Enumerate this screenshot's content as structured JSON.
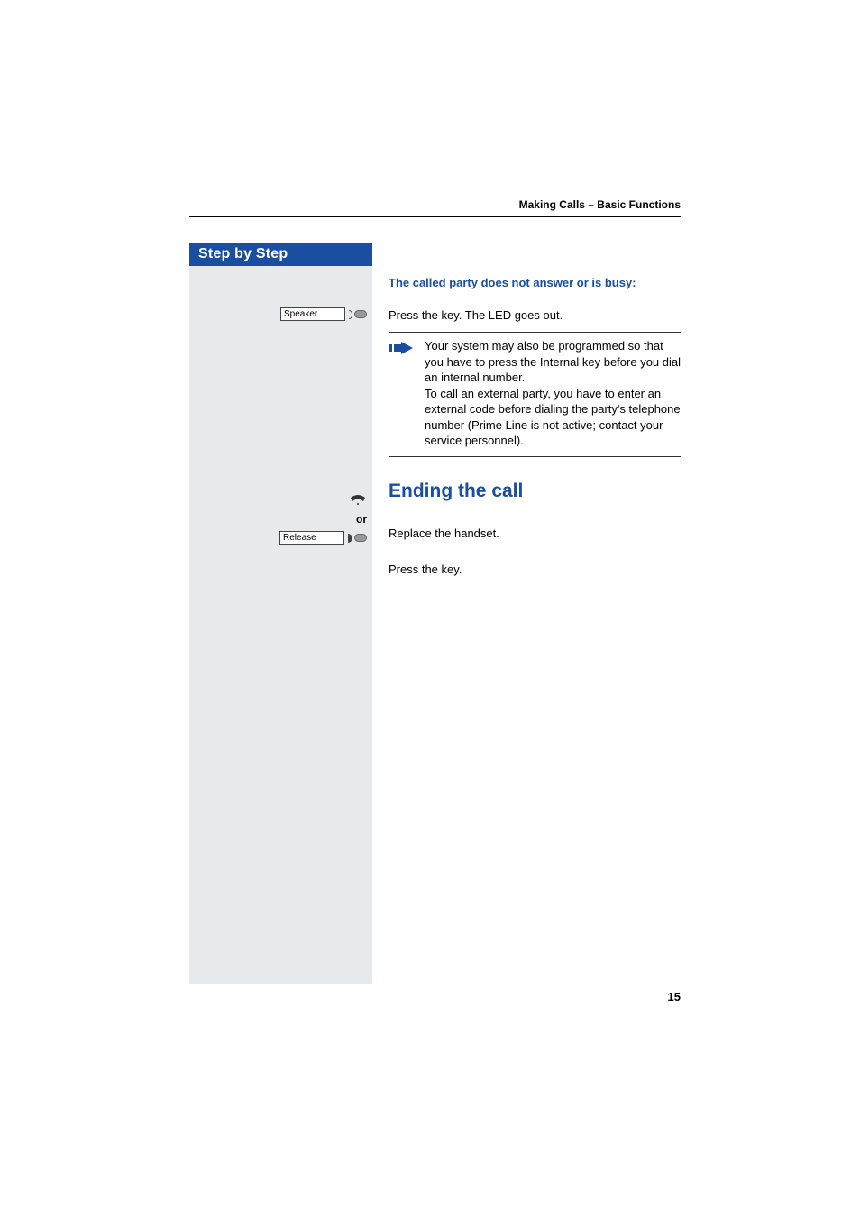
{
  "header": {
    "section_title": "Making Calls – Basic Functions"
  },
  "sidebar": {
    "title": "Step by Step",
    "items": {
      "speaker_label": "Speaker",
      "or_label": "or",
      "release_label": "Release"
    }
  },
  "content": {
    "sub1": "The called party does not answer or is busy:",
    "body1": "Press the key. The LED goes out.",
    "note": "Your system may also be programmed so that you have to press the Internal key before you dial an internal number.\nTo call an external party, you have to enter an external code before dialing the party's telephone number (Prime Line is not active; contact your service personnel).",
    "h2": "Ending the call",
    "body2": "Replace the handset.",
    "body3": "Press the key."
  },
  "page_number": "15"
}
